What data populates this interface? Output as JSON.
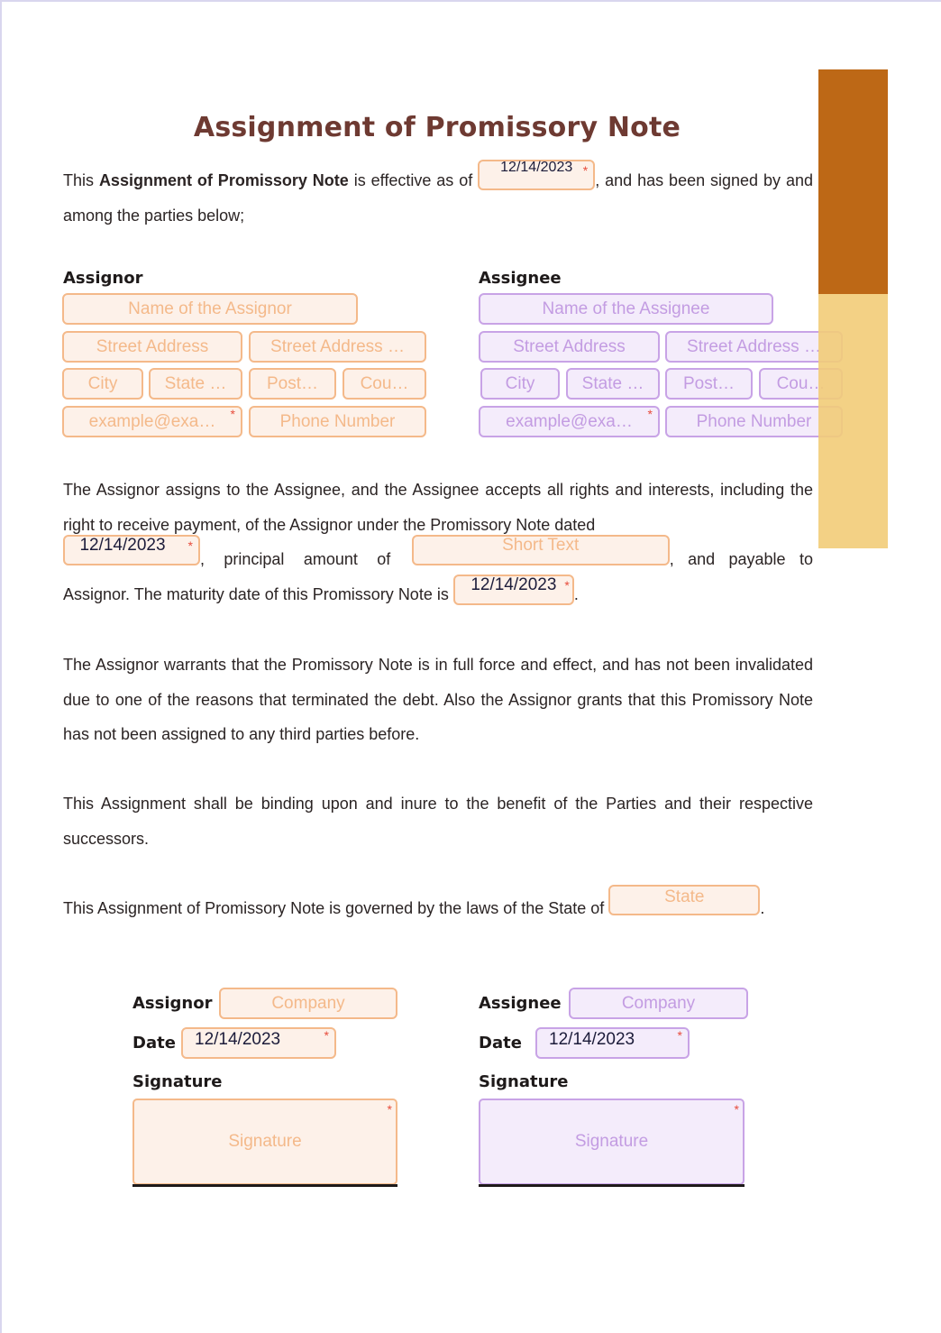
{
  "document": {
    "title": "Assignment of Promissory Note",
    "intro": {
      "prefix": "This ",
      "bold": "Assignment of Promissory Note",
      "middle": " is effective as of ",
      "effective_date": "12/14/2023",
      "suffix": ", and has been signed by and among the parties below;"
    },
    "assignor": {
      "heading": "Assignor",
      "name_placeholder": "Name of the Assignor",
      "street1_placeholder": "Street Address",
      "street2_placeholder": "Street Address …",
      "city_placeholder": "City",
      "state_placeholder": "State …",
      "postal_placeholder": "Post…",
      "country_placeholder": "Cou…",
      "email_placeholder": "example@exa…",
      "phone_placeholder": "Phone Number"
    },
    "assignee": {
      "heading": "Assignee",
      "name_placeholder": "Name of the Assignee",
      "street1_placeholder": "Street Address",
      "street2_placeholder": "Street Address …",
      "city_placeholder": "City",
      "state_placeholder": "State …",
      "postal_placeholder": "Post…",
      "country_placeholder": "Cou…",
      "email_placeholder": "example@exa…",
      "phone_placeholder": "Phone Number"
    },
    "clause1": {
      "text_a": "The Assignor assigns to the Assignee, and the Assignee accepts all rights and interests, including the right to receive payment, of the Assignor under the Promissory Note dated",
      "note_date": "12/14/2023",
      "text_b": ", principal amount of",
      "amount_placeholder": "Short Text",
      "text_c": ", and payable to Assignor. The maturity date of this Promissory Note is",
      "maturity_date": "12/14/2023",
      "text_d": "."
    },
    "clause2": "The Assignor warrants that the Promissory Note is in full force and effect, and has not been invalidated due to one of the reasons that terminated the debt. Also the Assignor grants that this Promissory Note has not been assigned to any third parties before.",
    "clause3": "This Assignment shall be binding upon and inure to the benefit of the Parties and their respective successors.",
    "clause4": {
      "text": "This Assignment of Promissory Note is governed by the laws of the State of",
      "state_placeholder": "State",
      "end": "."
    },
    "signatures": {
      "assignor": {
        "label": "Assignor",
        "company_placeholder": "Company",
        "date_label": "Date",
        "date_value": "12/14/2023",
        "signature_label": "Signature",
        "signature_placeholder": "Signature"
      },
      "assignee": {
        "label": "Assignee",
        "company_placeholder": "Company",
        "date_label": "Date",
        "date_value": "12/14/2023",
        "signature_label": "Signature",
        "signature_placeholder": "Signature"
      }
    },
    "required_mark": "*"
  },
  "colors": {
    "title": "#6e3a32",
    "assignor_accent": "#f4b98a",
    "assignee_accent": "#c8a3e6",
    "bar_dark": "#bd6816",
    "bar_light": "#f2cc78",
    "required": "#e74c3c"
  }
}
